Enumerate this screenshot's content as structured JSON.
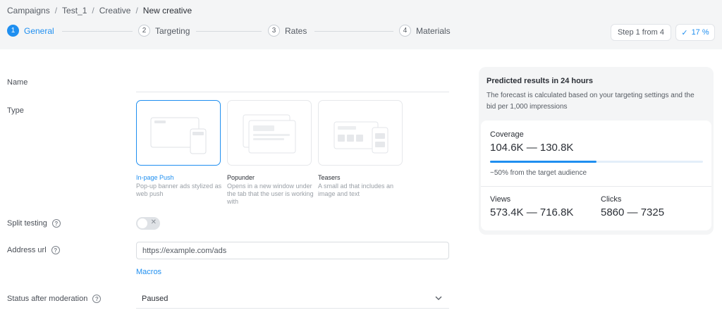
{
  "breadcrumb": {
    "items": [
      "Campaigns",
      "Test_1",
      "Creative"
    ],
    "current": "New creative",
    "separator": "/"
  },
  "stepper": {
    "steps": [
      {
        "num": "1",
        "label": "General",
        "active": true
      },
      {
        "num": "2",
        "label": "Targeting",
        "active": false
      },
      {
        "num": "3",
        "label": "Rates",
        "active": false
      },
      {
        "num": "4",
        "label": "Materials",
        "active": false
      }
    ],
    "step_info": "Step 1 from 4",
    "progress_label": "17 %",
    "progress_check": "✓"
  },
  "form": {
    "name_label": "Name",
    "type_label": "Type",
    "types": [
      {
        "title": "In-page Push",
        "desc": "Pop-up banner ads stylized as web push",
        "selected": true
      },
      {
        "title": "Popunder",
        "desc": "Opens in a new window under the tab that the user is working with",
        "selected": false
      },
      {
        "title": "Teasers",
        "desc": "A small ad that includes an image and text",
        "selected": false
      }
    ],
    "split_label": "Split testing",
    "split_toggle_x": "✕",
    "address_label": "Address url",
    "address_value": "https://example.com/ads",
    "macros_label": "Macros",
    "status_label": "Status after moderation",
    "status_value": "Paused",
    "help_glyph": "?"
  },
  "forecast": {
    "title": "Predicted results in 24 hours",
    "desc": "The forecast is calculated based on your targeting settings and the bid per 1,000 impressions",
    "coverage_label": "Coverage",
    "coverage_value": "104.6K — 130.8K",
    "coverage_fraction": 0.5,
    "coverage_note": "~50% from the target audience",
    "views_label": "Views",
    "views_value": "573.4K — 716.8K",
    "clicks_label": "Clicks",
    "clicks_value": "5860 — 7325"
  },
  "colors": {
    "accent": "#1f8ff0",
    "topbar_bg": "#f4f5f6",
    "panel_bg": "#f4f5f6"
  }
}
